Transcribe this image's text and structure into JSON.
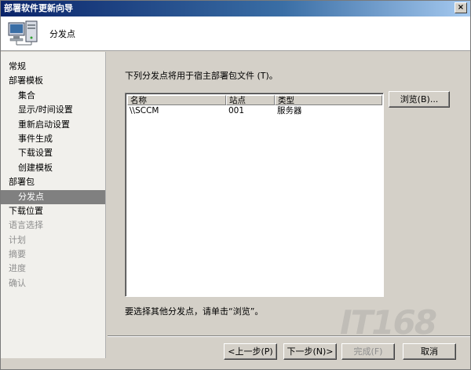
{
  "window": {
    "title": "部署软件更新向导",
    "close_glyph": "×"
  },
  "header": {
    "title": "分发点",
    "icon": "computer-network-icon"
  },
  "nav": {
    "items": [
      {
        "label": "常规",
        "state": "normal",
        "level": 0
      },
      {
        "label": "部署模板",
        "state": "normal",
        "level": 0
      },
      {
        "label": "集合",
        "state": "normal",
        "level": 1
      },
      {
        "label": "显示/时间设置",
        "state": "normal",
        "level": 1
      },
      {
        "label": "重新启动设置",
        "state": "normal",
        "level": 1
      },
      {
        "label": "事件生成",
        "state": "normal",
        "level": 1
      },
      {
        "label": "下载设置",
        "state": "normal",
        "level": 1
      },
      {
        "label": "创建模板",
        "state": "normal",
        "level": 1
      },
      {
        "label": "部署包",
        "state": "normal",
        "level": 0
      },
      {
        "label": "分发点",
        "state": "selected",
        "level": 1
      },
      {
        "label": "下载位置",
        "state": "normal",
        "level": 0
      },
      {
        "label": "语言选择",
        "state": "disabled",
        "level": 0
      },
      {
        "label": "计划",
        "state": "disabled",
        "level": 0
      },
      {
        "label": "摘要",
        "state": "disabled",
        "level": 0
      },
      {
        "label": "进度",
        "state": "disabled",
        "level": 0
      },
      {
        "label": "确认",
        "state": "disabled",
        "level": 0
      }
    ]
  },
  "main": {
    "prompt": "下列分发点将用于宿主部署包文件 (T)。",
    "table": {
      "columns": [
        "名称",
        "站点",
        "类型"
      ],
      "rows": [
        [
          "\\\\SCCM",
          "001",
          "服务器"
        ]
      ]
    },
    "browse_label": "浏览(B)...",
    "hint": "要选择其他分发点，请单击“浏览”。"
  },
  "footer": {
    "back_label": "<上一步(P)",
    "next_label": "下一步(N)>",
    "finish_label": "完成(F)",
    "cancel_label": "取消"
  },
  "watermark": "IT168"
}
